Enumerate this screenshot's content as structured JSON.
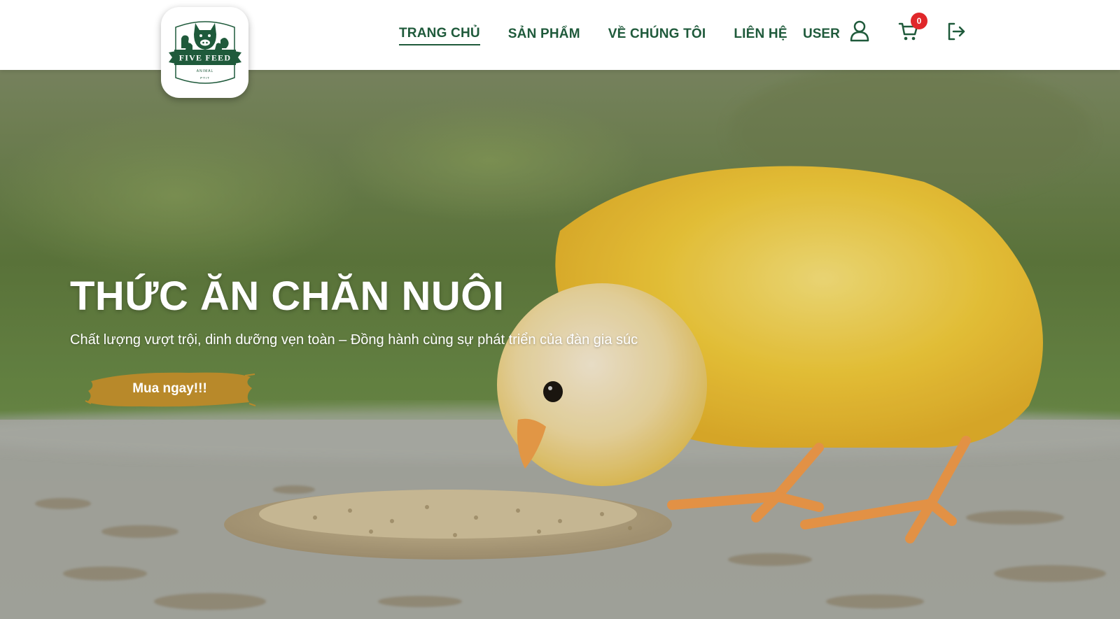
{
  "brand": {
    "logo_text": "FIVE FEED",
    "logo_sub": "ANIMAL",
    "logo_tag": "PTIT"
  },
  "nav": {
    "items": [
      {
        "label": "TRANG CHỦ",
        "active": true
      },
      {
        "label": "SẢN PHẨM",
        "active": false
      },
      {
        "label": "VỀ CHÚNG TÔI",
        "active": false
      },
      {
        "label": "LIÊN HỆ",
        "active": false
      }
    ],
    "user_label": "USER",
    "cart_count": "0",
    "icons": [
      "user-icon",
      "cart-icon",
      "logout-icon"
    ]
  },
  "hero": {
    "title": "THỨC ĂN CHĂN NUÔI",
    "subtitle": "Chất lượng vượt trội, dinh dưỡng vẹn toàn – Đồng hành cùng sự phát triển của đàn gia súc",
    "cta_label": "Mua ngay!!!"
  },
  "colors": {
    "brand_green": "#1f5a3b",
    "badge_red": "#e0272a",
    "cta_gold": "#b8892a",
    "chick_yellow": "#f2c737"
  }
}
